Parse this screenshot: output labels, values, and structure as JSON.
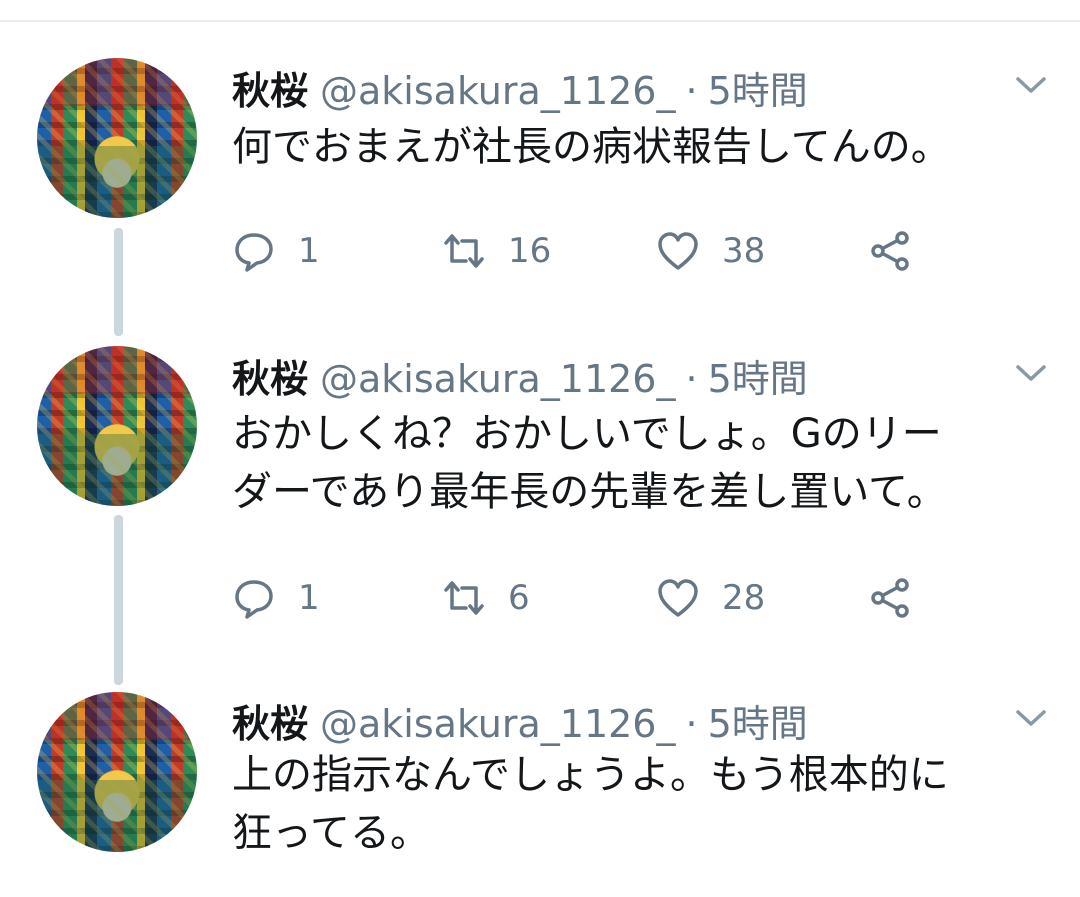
{
  "tweets": [
    {
      "name": "秋桜",
      "handle": "@akisakura_1126_",
      "time": "5時間",
      "text": "何でおまえが社長の病状報告してんの。",
      "actions": {
        "reply_count": "1",
        "retweet_count": "16",
        "like_count": "38"
      }
    },
    {
      "name": "秋桜",
      "handle": "@akisakura_1126_",
      "time": "5時間",
      "text": "おかしくね？おかしいでしょ。Gのリー\nダーであり最年長の先輩を差し置いて。",
      "actions": {
        "reply_count": "1",
        "retweet_count": "6",
        "like_count": "28"
      }
    },
    {
      "name": "秋桜",
      "handle": "@akisakura_1126_",
      "time": "5時間",
      "text": "上の指示なんでしょうよ。もう根本的に\n狂ってる。"
    }
  ],
  "separator": "·",
  "colors": {
    "text": "#14171a",
    "secondary": "#657786",
    "thread_line": "#ccd6dd",
    "divider": "#e6ecf0"
  },
  "icons": [
    "chevron-down-icon",
    "reply-icon",
    "retweet-icon",
    "like-icon",
    "share-icon"
  ]
}
